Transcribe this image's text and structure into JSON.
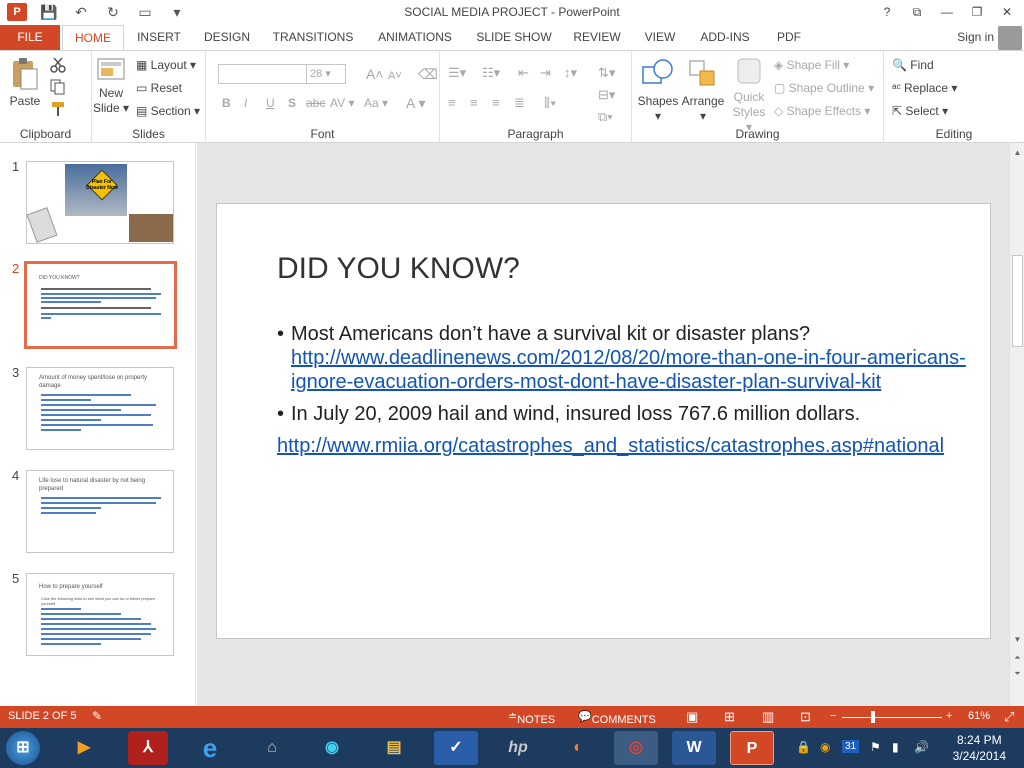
{
  "window": {
    "title": "SOCIAL MEDIA PROJECT - PowerPoint",
    "app_icon": "P",
    "controls": [
      "?",
      "⧉",
      "—",
      "❐",
      "✕"
    ]
  },
  "qat": {
    "save": "💾",
    "undo": "↶",
    "repeat": "↻",
    "present": "▭",
    "more": "▾"
  },
  "tabs": [
    "FILE",
    "HOME",
    "INSERT",
    "DESIGN",
    "TRANSITIONS",
    "ANIMATIONS",
    "SLIDE SHOW",
    "REVIEW",
    "VIEW",
    "ADD-INS",
    "PDF"
  ],
  "signin": "Sign in",
  "ribbon": {
    "clipboard": {
      "label": "Clipboard",
      "paste": "Paste"
    },
    "slides": {
      "label": "Slides",
      "new_slide_1": "New",
      "new_slide_2": "Slide",
      "layout": "Layout",
      "reset": "Reset",
      "section": "Section"
    },
    "font": {
      "label": "Font",
      "size": "28",
      "bold": "B",
      "italic": "I",
      "underline": "U",
      "shadow": "S",
      "strike": "abc",
      "spacing": "AV",
      "case": "Aa",
      "color": "A",
      "grow": "A",
      "shrink": "A"
    },
    "paragraph": {
      "label": "Paragraph"
    },
    "drawing": {
      "label": "Drawing",
      "shapes": "Shapes",
      "arrange": "Arrange",
      "quick_styles_1": "Quick",
      "quick_styles_2": "Styles",
      "shape_fill": "Shape Fill",
      "shape_outline": "Shape Outline",
      "shape_effects": "Shape Effects"
    },
    "editing": {
      "label": "Editing",
      "find": "Find",
      "replace": "Replace",
      "select": "Select"
    }
  },
  "thumbnails": [
    {
      "num": "1",
      "sign_text": "Plan For Disaster Now"
    },
    {
      "num": "2",
      "title": "DID YOU KNOW?"
    },
    {
      "num": "3",
      "title": "Amount of money spent/lose on property damage"
    },
    {
      "num": "4",
      "title": "Life lose to natural disaster by not being prepared"
    },
    {
      "num": "5",
      "title": "How to prepare yourself",
      "sub": "Click the following links to see what you can do to better prepare yourself"
    }
  ],
  "slide": {
    "title": "DID YOU KNOW?",
    "bullet1": "Most Americans don’t have a survival kit or disaster plans?",
    "link1": "http://www.deadlinenews.com/2012/08/20/more-than-one-in-four-americans-ignore-evacuation-orders-most-dont-have-disaster-plan-survival-kit",
    "bullet2": "In July 20, 2009 hail and wind, insured loss 767.6 million dollars.",
    "link2": "http://www.rmiia.org/catastrophes_and_statistics/catastrophes.asp#national"
  },
  "status": {
    "slide": "SLIDE 2 OF 5",
    "notes": "NOTES",
    "comments": "COMMENTS",
    "zoom": "61%",
    "zoom_fraction": 0.61
  },
  "taskbar": {
    "time": "8:24 PM",
    "date": "3/24/2014",
    "calendar_day": "31"
  },
  "colors": {
    "accent": "#d24726",
    "link": "#1155b5",
    "selected_thumb": "#e46c4a"
  }
}
